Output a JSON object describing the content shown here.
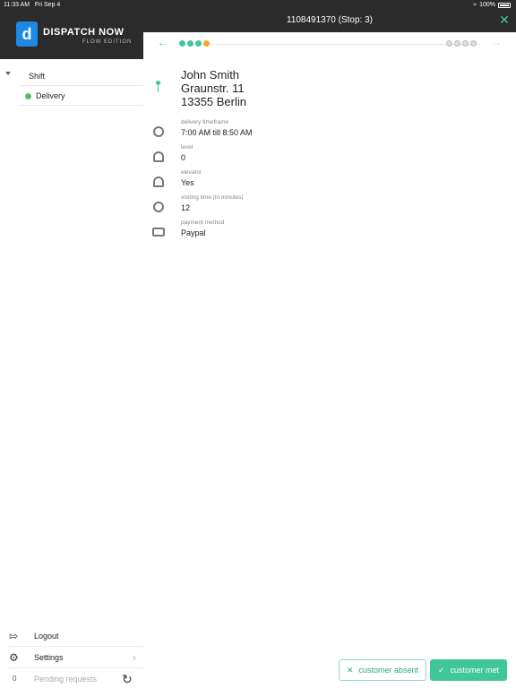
{
  "status_bar": {
    "time": "11:33 AM",
    "date": "Fri Sep 4",
    "battery": "100%"
  },
  "header": {
    "title": "1108491370 (Stop: 3)"
  },
  "logo": {
    "mark": "d",
    "name": "DISPATCH NOW",
    "sub": "FLOW EDITION"
  },
  "sidebar": {
    "tree": [
      {
        "label": "Shift"
      },
      {
        "label": "Delivery"
      }
    ],
    "bottom": {
      "logout": "Logout",
      "settings": "Settings",
      "pending_count": "0",
      "pending": "Pending requests"
    }
  },
  "progress": {
    "done_dots": 3,
    "current_dot": 1,
    "future_dots": 4
  },
  "address": {
    "name": "John Smith",
    "street": "Graunstr. 11",
    "city": "13355 Berlin"
  },
  "details": [
    {
      "caption": "delivery timeframe",
      "value": "7:00 AM till 8:50 AM",
      "icon": "clock-icon"
    },
    {
      "caption": "level",
      "value": "0",
      "icon": "gauge-icon"
    },
    {
      "caption": "elevator",
      "value": "Yes",
      "icon": "gauge-icon"
    },
    {
      "caption": "visiting time (in minutes)",
      "value": "12",
      "icon": "clock-icon"
    },
    {
      "caption": "payment method",
      "value": "Paypal",
      "icon": "money-icon"
    }
  ],
  "actions": {
    "absent": "customer absent",
    "met": "customer met"
  },
  "colors": {
    "accent": "#3fc79a",
    "header": "#2b2b2b",
    "current": "#f5a623"
  }
}
